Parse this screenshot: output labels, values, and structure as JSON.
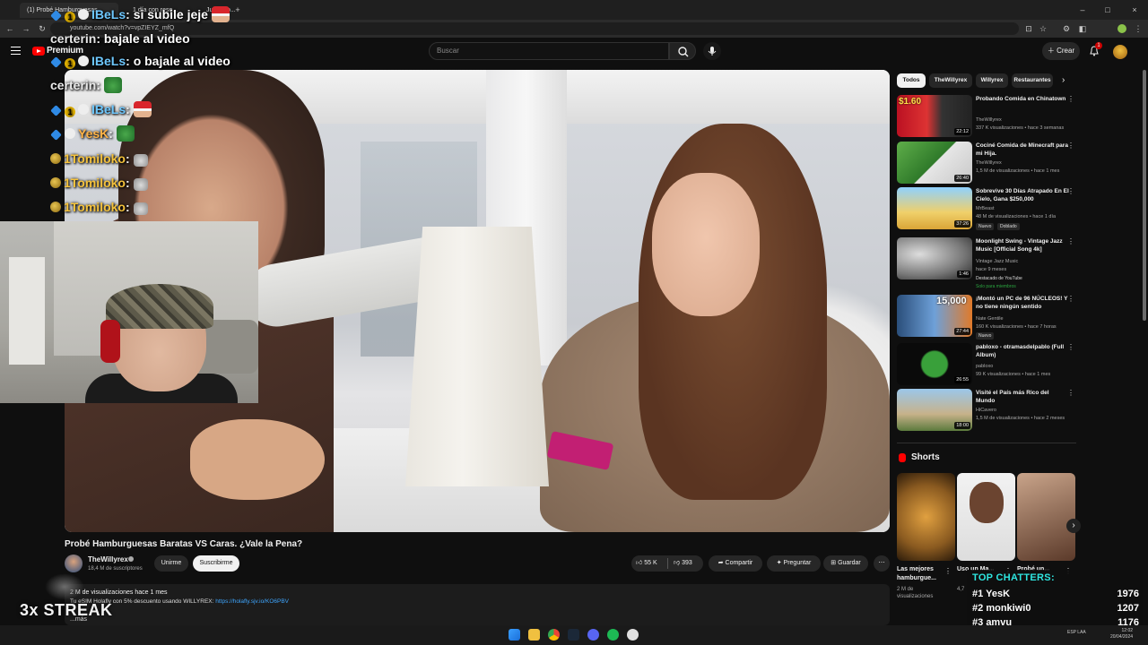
{
  "browser": {
    "tabs": [
      {
        "label": "(1) Probé Hamburguesas...",
        "active": true
      },
      {
        "label": "1 día con rese...",
        "active": false
      },
      {
        "label": "Jugando...",
        "active": false
      }
    ],
    "url": "youtube.com/watch?v=vpZIEYZ_mfQ"
  },
  "youtube": {
    "logo_text": "Premium",
    "search_placeholder": "Buscar",
    "create_label": "Crear",
    "notifications_count": "1"
  },
  "chat": [
    {
      "user": "IBeLs",
      "msg": "si subile jeje",
      "color": "#6ec8ff",
      "badges": [
        "blue",
        "gold",
        "white"
      ],
      "emote": "santa"
    },
    {
      "user": "certerin",
      "msg": "bajale al video",
      "color": "#e8e8e8",
      "badges": [],
      "emote": ""
    },
    {
      "user": "IBeLs",
      "msg": "o bajale al video",
      "color": "#6ec8ff",
      "badges": [
        "blue",
        "gold",
        "white"
      ],
      "emote": ""
    },
    {
      "user": "certerin",
      "msg": "",
      "color": "#e8e8e8",
      "badges": [],
      "emote": "green"
    },
    {
      "user": "IBeLs",
      "msg": "",
      "color": "#6ec8ff",
      "badges": [
        "blue",
        "gold",
        "white"
      ],
      "emote": "santa"
    },
    {
      "user": "YesK",
      "msg": "",
      "color": "#ffb347",
      "badges": [
        "blue",
        "white"
      ],
      "emote": "green"
    },
    {
      "user": "1Tomiloko",
      "msg": "",
      "color": "#f5c23c",
      "badges": [
        "coin"
      ],
      "emote": "cat"
    },
    {
      "user": "1Tomiloko",
      "msg": "",
      "color": "#f5c23c",
      "badges": [
        "coin"
      ],
      "emote": "cat"
    },
    {
      "user": "1Tomiloko",
      "msg": "",
      "color": "#f5c23c",
      "badges": [
        "coin"
      ],
      "emote": "cat"
    }
  ],
  "video": {
    "title": "Probé Hamburguesas Baratas VS Caras. ¿Vale la Pena?",
    "channel": "TheWillyrex",
    "subscribers": "18,4 M de suscriptores",
    "join_label": "Unirme",
    "subscribe_label": "Suscribirme",
    "likes": "55 K",
    "dislikes": "393",
    "share_label": "Compartir",
    "ask_label": "Preguntar",
    "save_label": "Guardar",
    "views_time": "2 M de visualizaciones  hace 1 mes",
    "desc_line": "Tu eSIM Holafly con 5% descuento usando WILLYREX: ",
    "desc_link": "https://holafly.sjv.io/KO6PBV",
    "desc_more": "...más"
  },
  "streak": "3x STREAK",
  "chips": [
    "Todos",
    "TheWillyrex",
    "Willyrex",
    "Restaurantes"
  ],
  "recommendations": [
    {
      "title": "Probando Comida en Chinatown",
      "channel": "TheWillyrex",
      "meta": "337 K visualizaciones • hace 3 semanas",
      "duration": "22:12",
      "price": "$1.60",
      "tag": "",
      "extra": ""
    },
    {
      "title": "Cociné Comida de Minecraft para mi Hija.",
      "channel": "TheWillyrex",
      "meta": "1,5 M de visualizaciones • hace 1 mes",
      "duration": "26:40",
      "tag": "",
      "extra": ""
    },
    {
      "title": "Sobrevive 30 Días Atrapado En El Cielo, Gana $250,000",
      "channel": "MrBeast",
      "meta": "48 M de visualizaciones • hace 1 día",
      "duration": "37:26",
      "tag": "Nuevo",
      "extra": "Doblado"
    },
    {
      "title": "Moonlight Swing - Vintage Jazz Music [Official Song 4k]",
      "channel": "Vintage Jazz Music",
      "meta": "hace 9 meses",
      "duration": "1:46",
      "tag": "Destacado de YouTube",
      "extra": "Solo para miembros"
    },
    {
      "title": "¡Montó un PC de 96 NÚCLEOS! Y no tiene ningún sentido",
      "channel": "Nate Gentile",
      "meta": "160 K visualizaciones • hace 7 horas",
      "duration": "27:44",
      "price": "15,000",
      "tag": "Nuevo",
      "extra": ""
    },
    {
      "title": "pabloxo - otramasdelpablo (Full Album)",
      "channel": "pabloxo",
      "meta": "99 K visualizaciones • hace 1 mes",
      "duration": "26:55",
      "tag": "",
      "extra": ""
    },
    {
      "title": "Visité el País más Rico del Mundo",
      "channel": "HiCavero",
      "meta": "1,5 M de visualizaciones • hace 2 meses",
      "duration": "18:00",
      "tag": "",
      "extra": ""
    }
  ],
  "shorts": {
    "label": "Shorts",
    "items": [
      {
        "title": "Las mejores hamburgue...",
        "meta": "2 M de visualizaciones"
      },
      {
        "title": "Uso un Ma...",
        "meta": "4,7"
      },
      {
        "title": "Probé un...",
        "meta": ""
      }
    ]
  },
  "top_chatters": {
    "title": "TOP CHATTERS:",
    "rows": [
      {
        "rank": "#1",
        "name": "YesK",
        "count": "1976"
      },
      {
        "rank": "#2",
        "name": "monkiwi0",
        "count": "1207"
      },
      {
        "rank": "#3",
        "name": "amvu",
        "count": "1176"
      }
    ]
  },
  "taskbar": {
    "lang": "ESP LAA",
    "date": "20/04/2024",
    "time": "12:02"
  },
  "colors": {
    "brand_red": "#ff0000",
    "link_blue": "#3ea6ff",
    "chatters_cyan": "#2ee6e0"
  }
}
